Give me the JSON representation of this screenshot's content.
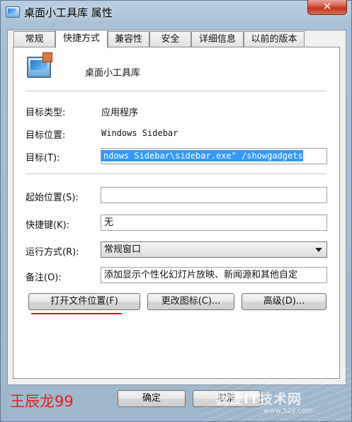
{
  "window": {
    "title": "桌面小工具库 属性",
    "close_label": "✕"
  },
  "tabs": [
    {
      "label": "常规"
    },
    {
      "label": "快捷方式"
    },
    {
      "label": "兼容性"
    },
    {
      "label": "安全"
    },
    {
      "label": "详细信息"
    },
    {
      "label": "以前的版本"
    }
  ],
  "active_tab": "快捷方式",
  "shortcut": {
    "name": "桌面小工具库",
    "target_type_label": "目标类型:",
    "target_type_value": "应用程序",
    "target_location_label": "目标位置:",
    "target_location_value": "Windows Sidebar",
    "target_label": "目标(T):",
    "target_value": "ndows Sidebar\\sidebar.exe\" /showgadgets",
    "start_in_label": "起始位置(S):",
    "start_in_value": "",
    "hotkey_label": "快捷键(K):",
    "hotkey_value": "无",
    "run_label": "运行方式(R):",
    "run_value": "常规窗口",
    "comment_label": "备注(O):",
    "comment_value": "添加显示个性化幻灯片放映、新闻源和其他自定"
  },
  "buttons": {
    "open_location": "打开文件位置(F)",
    "change_icon": "更改图标(C)...",
    "advanced": "高级(D)...",
    "ok": "确定",
    "cancel": "取消"
  },
  "watermarks": {
    "left": "王辰龙99",
    "right": "我爱IT技术网",
    "site": "www.52ij.com"
  },
  "colors": {
    "selection": "#3399ff",
    "underline": "#d61a1a",
    "close": "#c2331b"
  }
}
